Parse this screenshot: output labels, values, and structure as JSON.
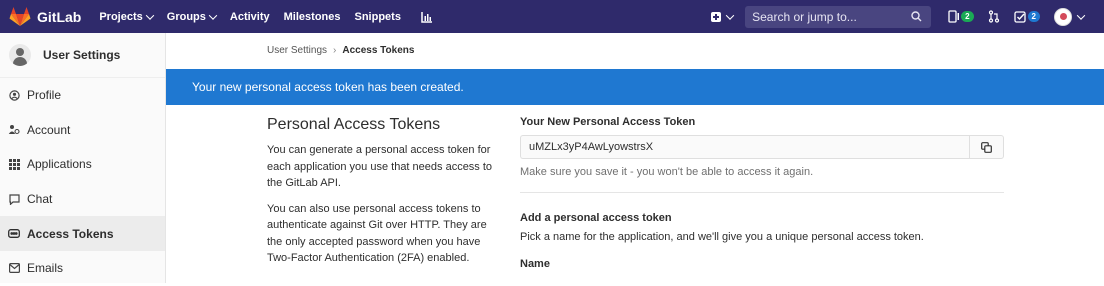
{
  "navbar": {
    "brand": "GitLab",
    "links": [
      {
        "label": "Projects",
        "dropdown": true
      },
      {
        "label": "Groups",
        "dropdown": true
      },
      {
        "label": "Activity",
        "dropdown": false
      },
      {
        "label": "Milestones",
        "dropdown": false
      },
      {
        "label": "Snippets",
        "dropdown": false
      }
    ],
    "search_placeholder": "Search or jump to...",
    "issues_count": "2",
    "todos_count": "2",
    "icons": [
      "chart-icon",
      "plus-icon",
      "issues-icon",
      "merge-request-icon",
      "todos-icon",
      "search-icon"
    ]
  },
  "sidebar": {
    "title": "User Settings",
    "items": [
      {
        "label": "Profile",
        "icon": "profile-icon",
        "active": false
      },
      {
        "label": "Account",
        "icon": "account-icon",
        "active": false
      },
      {
        "label": "Applications",
        "icon": "applications-icon",
        "active": false
      },
      {
        "label": "Chat",
        "icon": "chat-icon",
        "active": false
      },
      {
        "label": "Access Tokens",
        "icon": "access-tokens-icon",
        "active": true
      },
      {
        "label": "Emails",
        "icon": "emails-icon",
        "active": false
      }
    ]
  },
  "breadcrumb": {
    "parent": "User Settings",
    "current": "Access Tokens"
  },
  "flash": {
    "message": "Your new personal access token has been created."
  },
  "intro": {
    "title": "Personal Access Tokens",
    "paragraph1": "You can generate a personal access token for each application you use that needs access to the GitLab API.",
    "paragraph2": "You can also use personal access tokens to authenticate against Git over HTTP. They are the only accepted password when you have Two-Factor Authentication (2FA) enabled."
  },
  "new_token": {
    "label": "Your New Personal Access Token",
    "value": "uMZLx3yP4AwLyowstrsX",
    "hint": "Make sure you save it - you won't be able to access it again."
  },
  "add_token": {
    "title": "Add a personal access token",
    "description": "Pick a name for the application, and we'll give you a unique personal access token.",
    "name_label": "Name"
  },
  "colors": {
    "navbar_bg": "#2f2a6b",
    "flash_bg": "#1f78d1",
    "badge_green": "#1aaa55",
    "badge_blue": "#1f78d1"
  }
}
